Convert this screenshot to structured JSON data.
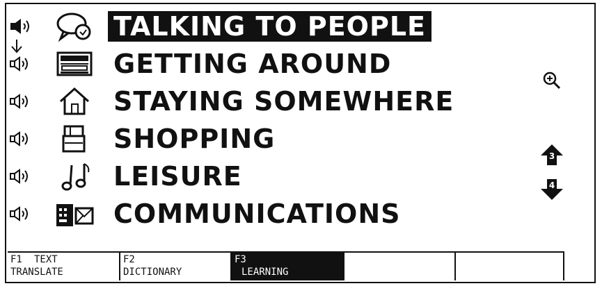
{
  "menu": {
    "items": [
      {
        "label": "TALKING TO PEOPLE",
        "icon": "speech-bubble-icon",
        "selected": true
      },
      {
        "label": "GETTING AROUND",
        "icon": "train-icon",
        "selected": false
      },
      {
        "label": "STAYING SOMEWHERE",
        "icon": "house-icon",
        "selected": false
      },
      {
        "label": "SHOPPING",
        "icon": "shopping-bag-icon",
        "selected": false
      },
      {
        "label": "LEISURE",
        "icon": "music-notes-icon",
        "selected": false
      },
      {
        "label": "COMMUNICATIONS",
        "icon": "phone-mail-icon",
        "selected": false
      }
    ]
  },
  "side": {
    "zoom_icon": "magnifier-plus-icon",
    "page_up_label": "3",
    "page_down_label": "4"
  },
  "function_keys": [
    {
      "key": "F1",
      "line1": "TEXT",
      "line2": "TRANSLATE"
    },
    {
      "key": "F2",
      "line1": "",
      "line2": "DICTIONARY"
    },
    {
      "key": "F3",
      "line1": "",
      "line2": "LEARNING"
    }
  ],
  "colors": {
    "foreground": "#111111",
    "background": "#ffffff"
  }
}
